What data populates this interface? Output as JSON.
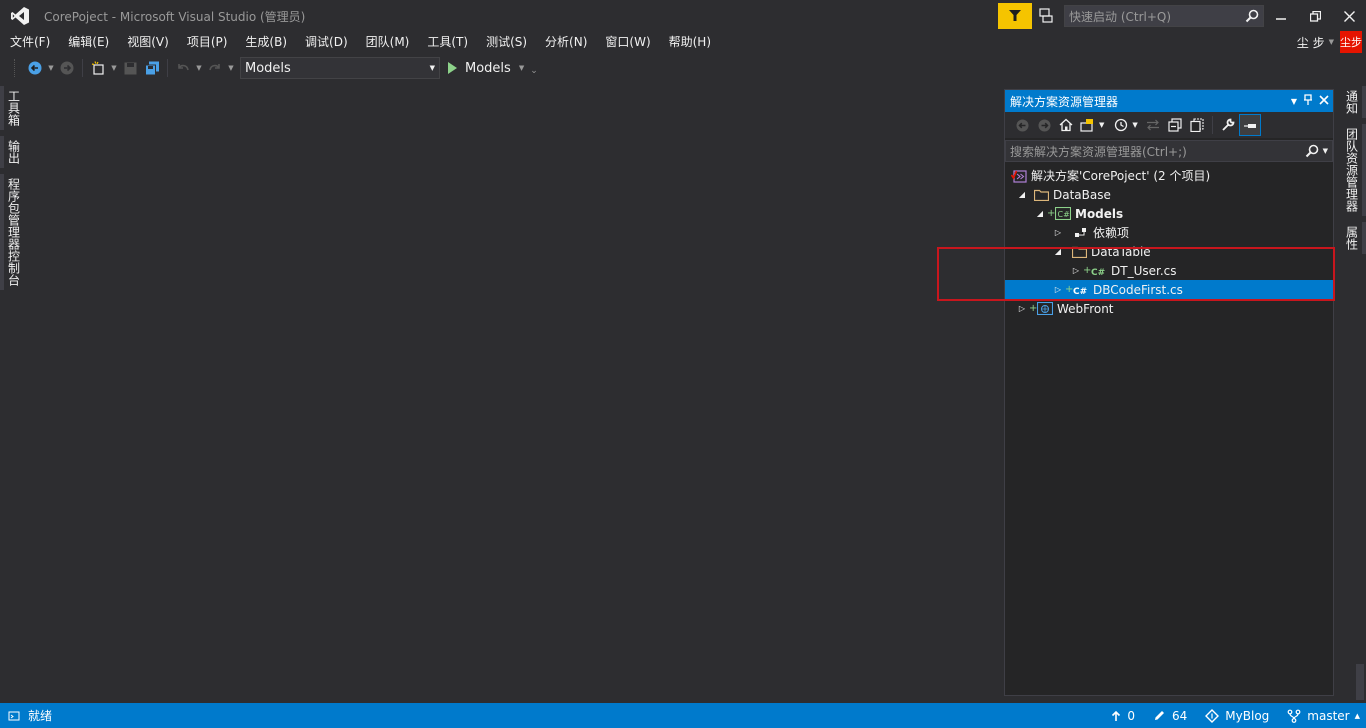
{
  "window": {
    "title": "CorePoject - Microsoft Visual Studio (管理员)",
    "quick_launch_placeholder": "快速启动 (Ctrl+Q)"
  },
  "menu": {
    "items": [
      "文件(F)",
      "编辑(E)",
      "视图(V)",
      "项目(P)",
      "生成(B)",
      "调试(D)",
      "团队(M)",
      "工具(T)",
      "测试(S)",
      "分析(N)",
      "窗口(W)",
      "帮助(H)"
    ],
    "user_name": "尘 步",
    "user_avatar_text": "尘步"
  },
  "toolbar": {
    "config_value": "Models",
    "run_label": "Models"
  },
  "left_tabs": [
    "工具箱",
    "输出",
    "程序包管理器控制台"
  ],
  "right_tabs": [
    "通知",
    "团队资源管理器",
    "属性"
  ],
  "solution_explorer": {
    "title": "解决方案资源管理器",
    "search_placeholder": "搜索解决方案资源管理器(Ctrl+;)",
    "tree": [
      {
        "label": "解决方案'CorePoject' (2 个项目)",
        "indent": 0,
        "expander": "",
        "icon": "solution-icon"
      },
      {
        "label": "DataBase",
        "indent": 1,
        "expander": "◢",
        "icon": "folder-icon"
      },
      {
        "label": "Models",
        "indent": 2,
        "expander": "◢",
        "icon": "csharp-project-icon",
        "bold": true
      },
      {
        "label": "依赖项",
        "indent": 3,
        "expander": "▷",
        "icon": "dependencies-icon"
      },
      {
        "label": "DataTable",
        "indent": 3,
        "expander": "◢",
        "icon": "folder-icon"
      },
      {
        "label": "DT_User.cs",
        "indent": 4,
        "expander": "▷",
        "icon": "csharp-file-icon"
      },
      {
        "label": "DBCodeFirst.cs",
        "indent": 3,
        "expander": "▷",
        "icon": "csharp-file-icon",
        "selected": true
      },
      {
        "label": "WebFront",
        "indent": 1,
        "expander": "▷",
        "icon": "web-project-icon"
      }
    ]
  },
  "status": {
    "ready": "就绪",
    "push_count": "0",
    "changes_count": "64",
    "repo": "MyBlog",
    "branch": "master"
  },
  "colors": {
    "accent": "#007acc",
    "background": "#2d2d30",
    "highlight_box": "#c8161d",
    "avatar": "#e51400"
  }
}
